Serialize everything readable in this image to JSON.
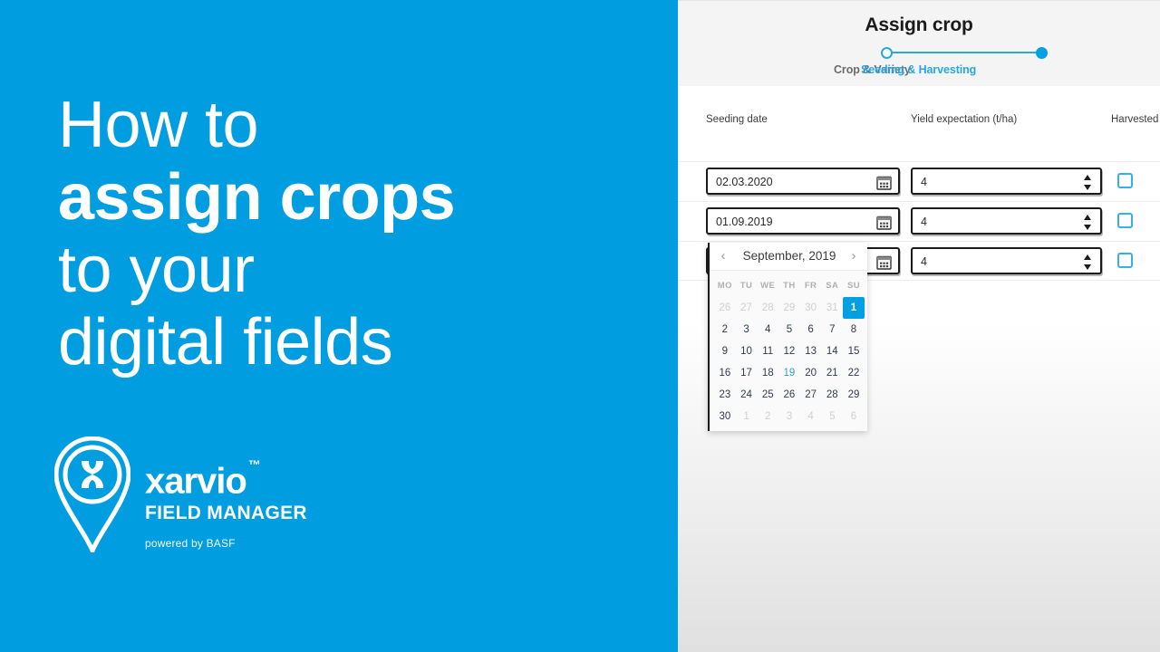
{
  "brand": {
    "color": "#009ee0",
    "headline_lines": [
      "How to",
      "assign crops",
      "to your",
      "digital fields"
    ],
    "name": "xarvio",
    "trademark": "™",
    "subtitle": "FIELD MANAGER",
    "powered_by": "powered by BASF",
    "logo_icon": "map-pin-x-logo"
  },
  "app": {
    "title": "Assign crop",
    "accent": "#00a0e1",
    "stepper": {
      "steps": [
        {
          "label": "Crop & Variety",
          "state": "inactive"
        },
        {
          "label": "Seeding & Harvesting",
          "state": "active"
        }
      ]
    },
    "columns": {
      "seeding_date": "Seeding date",
      "yield_expectation": "Yield expectation (t/ha)",
      "harvested": "Harvested"
    },
    "rows": [
      {
        "seeding_date": "02.03.2020",
        "yield": "4",
        "harvested": false
      },
      {
        "seeding_date": "01.09.2019",
        "yield": "4",
        "harvested": false
      },
      {
        "seeding_date": "",
        "yield": "4",
        "harvested": false
      }
    ],
    "icons": {
      "calendar": "calendar-icon",
      "spinner": "stepper-arrows-icon",
      "checkbox": "checkbox-icon",
      "prev": "chevron-left-icon",
      "next": "chevron-right-icon",
      "cursor": "hand-pointer-cursor"
    }
  },
  "calendar": {
    "month_label": "September, 2019",
    "prev_glyph": "‹",
    "next_glyph": "›",
    "weekdays": [
      "MO",
      "TU",
      "WE",
      "TH",
      "FR",
      "SA",
      "SU"
    ],
    "selected_day": 1,
    "hovered_day": 19,
    "weeks": [
      [
        {
          "d": "26",
          "o": true
        },
        {
          "d": "27",
          "o": true
        },
        {
          "d": "28",
          "o": true
        },
        {
          "d": "29",
          "o": true
        },
        {
          "d": "30",
          "o": true
        },
        {
          "d": "31",
          "o": true
        },
        {
          "d": "1",
          "sel": true
        }
      ],
      [
        {
          "d": "2"
        },
        {
          "d": "3"
        },
        {
          "d": "4"
        },
        {
          "d": "5"
        },
        {
          "d": "6"
        },
        {
          "d": "7"
        },
        {
          "d": "8"
        }
      ],
      [
        {
          "d": "9"
        },
        {
          "d": "10"
        },
        {
          "d": "11"
        },
        {
          "d": "12"
        },
        {
          "d": "13"
        },
        {
          "d": "14"
        },
        {
          "d": "15"
        }
      ],
      [
        {
          "d": "16"
        },
        {
          "d": "17"
        },
        {
          "d": "18"
        },
        {
          "d": "19",
          "hov": true
        },
        {
          "d": "20"
        },
        {
          "d": "21"
        },
        {
          "d": "22"
        }
      ],
      [
        {
          "d": "23"
        },
        {
          "d": "24"
        },
        {
          "d": "25"
        },
        {
          "d": "26"
        },
        {
          "d": "27"
        },
        {
          "d": "28"
        },
        {
          "d": "29"
        }
      ],
      [
        {
          "d": "30"
        },
        {
          "d": "1",
          "o": true
        },
        {
          "d": "2",
          "o": true
        },
        {
          "d": "3",
          "o": true
        },
        {
          "d": "4",
          "o": true
        },
        {
          "d": "5",
          "o": true
        },
        {
          "d": "6",
          "o": true
        }
      ]
    ]
  }
}
